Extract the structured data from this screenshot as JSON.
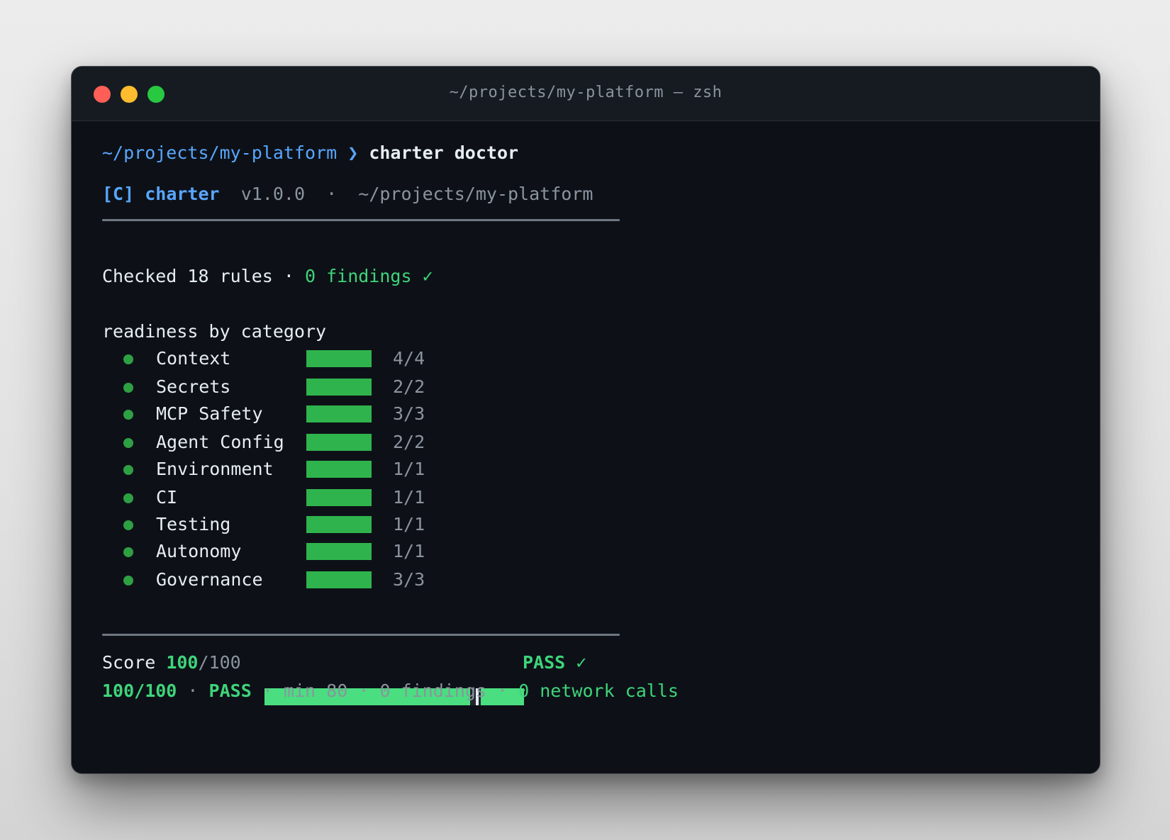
{
  "window": {
    "title": "~/projects/my-platform — zsh"
  },
  "prompt": {
    "cwd": "~/projects/my-platform",
    "arrow": "❯",
    "command": "charter doctor"
  },
  "header": {
    "logo": "[C]",
    "app_name": "charter",
    "version": "v1.0.0",
    "sep": "·",
    "path": "~/projects/my-platform"
  },
  "summary": {
    "prefix": "Checked 18 rules ·",
    "findings": "0 findings ✓"
  },
  "readiness": {
    "heading": "readiness by category",
    "categories": [
      {
        "label": "Context",
        "count": "4/4",
        "fill": 1.0
      },
      {
        "label": "Secrets",
        "count": "2/2",
        "fill": 1.0
      },
      {
        "label": "MCP Safety",
        "count": "3/3",
        "fill": 1.0
      },
      {
        "label": "Agent Config",
        "count": "2/2",
        "fill": 1.0
      },
      {
        "label": "Environment",
        "count": "1/1",
        "fill": 1.0
      },
      {
        "label": "CI",
        "count": "1/1",
        "fill": 1.0
      },
      {
        "label": "Testing",
        "count": "1/1",
        "fill": 1.0
      },
      {
        "label": "Autonomy",
        "count": "1/1",
        "fill": 1.0
      },
      {
        "label": "Governance",
        "count": "3/3",
        "fill": 1.0
      }
    ]
  },
  "score": {
    "label": "Score",
    "value": "100",
    "max": "/100",
    "fraction": 1.0,
    "threshold_fraction": 0.8,
    "status": "PASS ✓"
  },
  "footer": {
    "score": "100/100",
    "sep": "·",
    "status": "PASS",
    "min": "min 80",
    "findings": "0 findings",
    "network": "0 network calls"
  },
  "colors": {
    "accent_blue": "#58a6ff",
    "success_green": "#3fd47a",
    "bar_green": "#2fb44d",
    "background": "#0d1117"
  }
}
